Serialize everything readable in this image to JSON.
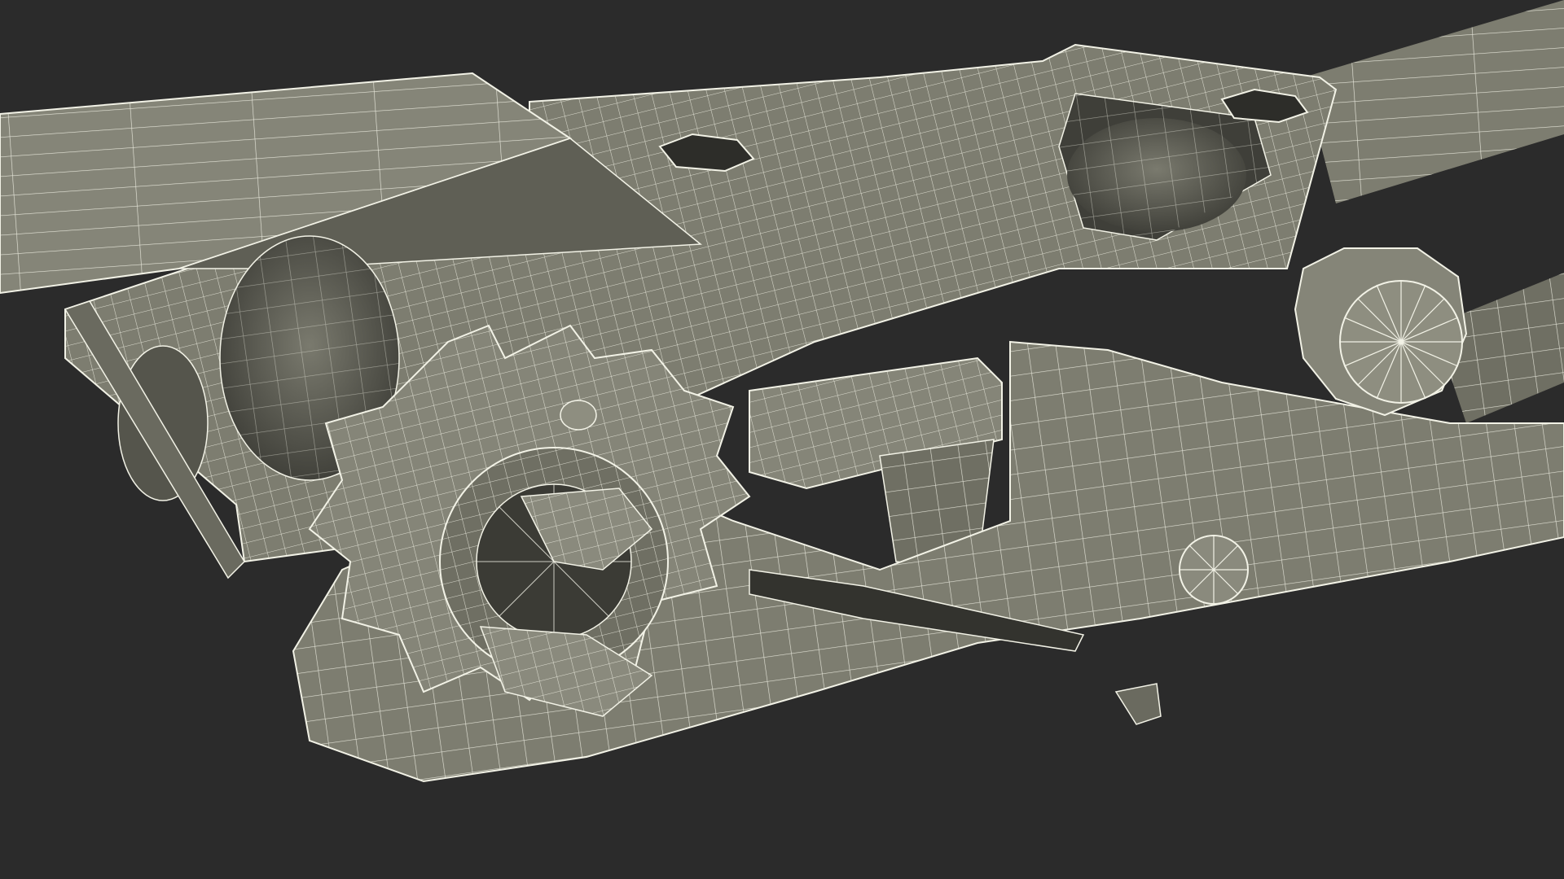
{
  "scene": {
    "colors": {
      "background": "#2b2b2b",
      "surface": "#7d7d70",
      "surface_light": "#8e8e80",
      "surface_dark": "#5d5d53",
      "shadow": "#3a3a35",
      "wire": "#f2f2e6"
    }
  }
}
